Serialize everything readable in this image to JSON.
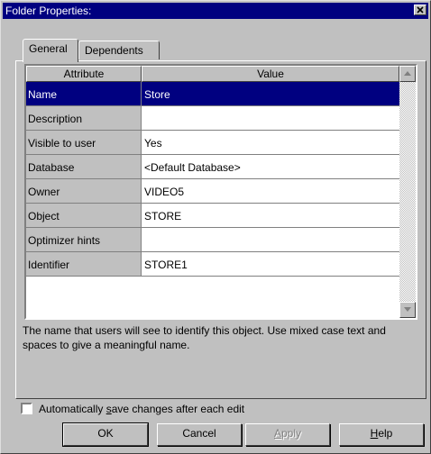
{
  "window": {
    "title": "Folder Properties:"
  },
  "tabs": [
    {
      "label": "General",
      "active": true
    },
    {
      "label": "Dependents",
      "active": false
    }
  ],
  "grid": {
    "columns": [
      "Attribute",
      "Value"
    ],
    "rows": [
      {
        "attribute": "Name",
        "value": "Store",
        "selected": true
      },
      {
        "attribute": "Description",
        "value": ""
      },
      {
        "attribute": "Visible to user",
        "value": "Yes"
      },
      {
        "attribute": "Database",
        "value": "<Default Database>"
      },
      {
        "attribute": "Owner",
        "value": "VIDEO5"
      },
      {
        "attribute": "Object",
        "value": "STORE"
      },
      {
        "attribute": "Optimizer hints",
        "value": ""
      },
      {
        "attribute": "Identifier",
        "value": "STORE1"
      }
    ]
  },
  "description": "The name that users will see to identify this object. Use mixed case text and spaces to give a meaningful name.",
  "autosave": {
    "label_pre": "Automatically ",
    "label_mnemonic": "s",
    "label_post": "ave changes after each edit",
    "checked": false
  },
  "buttons": {
    "ok": "OK",
    "cancel": "Cancel",
    "apply_mnemonic": "A",
    "apply_rest": "pply",
    "help_mnemonic": "H",
    "help_rest": "elp"
  },
  "colors": {
    "titlebar": "#000080",
    "selection": "#000080",
    "face": "#c0c0c0"
  }
}
